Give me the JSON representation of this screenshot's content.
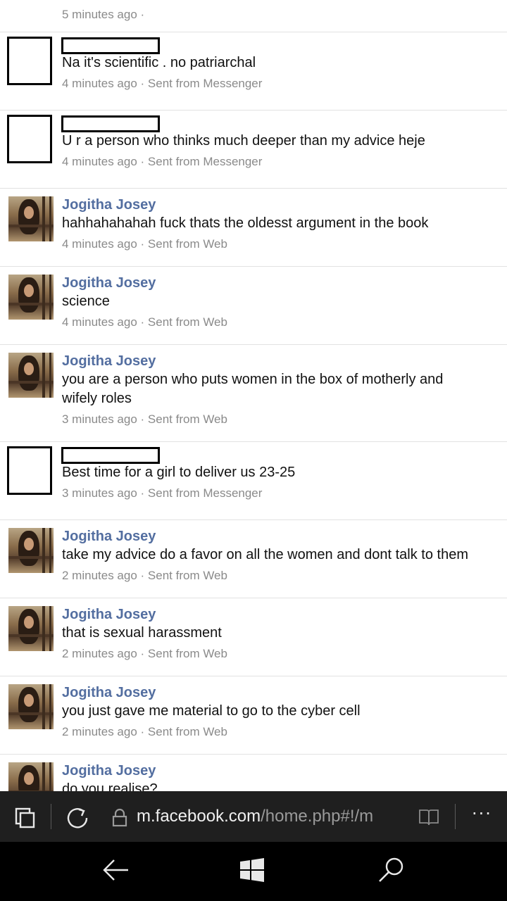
{
  "feed": {
    "top_meta": "5 minutes ago ·",
    "messages": [
      {
        "name": "",
        "redacted": true,
        "text_lines": [
          "Na it's scientific . no patriarchal"
        ],
        "time": "4 minutes ago",
        "source": "Sent from Messenger"
      },
      {
        "name": "",
        "redacted": true,
        "text_lines": [
          "U r a person who thinks much deeper than my advice heje"
        ],
        "time": "4 minutes ago",
        "source": "Sent from Messenger"
      },
      {
        "name": "Jogitha Josey",
        "redacted": false,
        "text_lines": [
          "hahhahahahah fuck thats the oldesst argument in the book"
        ],
        "time": "4 minutes ago",
        "source": "Sent from Web"
      },
      {
        "name": "Jogitha Josey",
        "redacted": false,
        "text_lines": [
          "science"
        ],
        "time": "4 minutes ago",
        "source": "Sent from Web"
      },
      {
        "name": "Jogitha Josey",
        "redacted": false,
        "text_lines": [
          "you are a person who puts women in the box of motherly and",
          "wifely roles"
        ],
        "time": "3 minutes ago",
        "source": "Sent from Web"
      },
      {
        "name": "",
        "redacted": true,
        "text_lines": [
          "Best time for a girl to deliver us 23-25"
        ],
        "time": "3 minutes ago",
        "source": "Sent from Messenger"
      },
      {
        "name": "Jogitha Josey",
        "redacted": false,
        "text_lines": [
          "take my advice do a favor on all the women and dont talk to them"
        ],
        "time": "2 minutes ago",
        "source": "Sent from Web"
      },
      {
        "name": "Jogitha Josey",
        "redacted": false,
        "text_lines": [
          "that is sexual harassment"
        ],
        "time": "2 minutes ago",
        "source": "Sent from Web"
      },
      {
        "name": "Jogitha Josey",
        "redacted": false,
        "text_lines": [
          "you just gave me material to go to the cyber cell"
        ],
        "time": "2 minutes ago",
        "source": "Sent from Web"
      },
      {
        "name": "Jogitha Josey",
        "redacted": false,
        "text_lines": [
          "do you realise?"
        ],
        "time": "",
        "source": ""
      }
    ]
  },
  "address_bar": {
    "url_host": "m.facebook.com",
    "url_path": "/home.php#!/m",
    "tabs_icon": "tabs-icon",
    "refresh_icon": "refresh-icon",
    "lock_icon": "lock-icon",
    "reading_view_icon": "reading-view-icon",
    "more_label": "···"
  },
  "navigation_bar": {
    "back_icon": "back-arrow-icon",
    "start_icon": "windows-start-icon",
    "search_icon": "search-icon"
  },
  "colors": {
    "name_link": "#536ea0",
    "meta_text": "#8a8a8a",
    "address_bar_bg": "#1f1f1f",
    "nav_bar_bg": "#000000"
  }
}
